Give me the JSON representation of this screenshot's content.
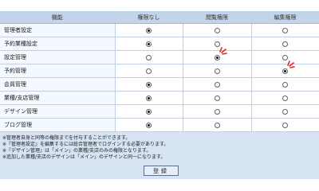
{
  "table": {
    "headers": {
      "function": "機能",
      "none": "権限なし",
      "view": "閲覧権限",
      "edit": "編集権限"
    },
    "rows": [
      {
        "label": "管理者設定",
        "selected": "none"
      },
      {
        "label": "予約業種設定",
        "selected": "none"
      },
      {
        "label": "設定管理",
        "selected": "view"
      },
      {
        "label": "予約管理",
        "selected": "edit"
      },
      {
        "label": "会員管理",
        "selected": "none"
      },
      {
        "label": "業種/支店管理",
        "selected": "none"
      },
      {
        "label": "デザイン管理",
        "selected": "none"
      },
      {
        "label": "ブログ管理",
        "selected": "none"
      }
    ]
  },
  "notes": [
    "※管理者自身と同等の権限までを付与することができます。",
    "※『管理者設定』を編集するには総合管理者でログインする必要があります。",
    "※『デザイン管理』は「メイン」の業種/支店のみの権限となります。",
    "※追加した業種/支店のデザインは「メイン」のデザインと同一になります。"
  ],
  "button": {
    "label": "登録"
  },
  "colors": {
    "header_bg": "#c3d3ea",
    "panel_bg": "#d5e3f3",
    "marker_red": "#e0231b"
  }
}
